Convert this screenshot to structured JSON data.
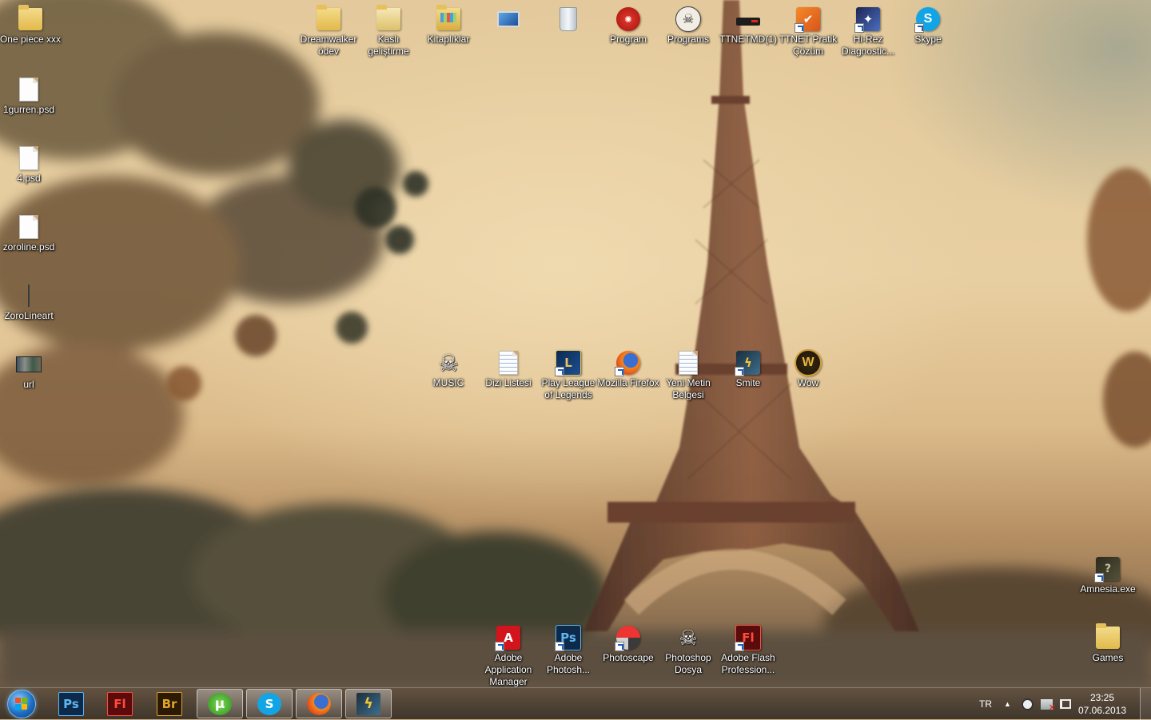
{
  "desktop": {
    "icons": [
      {
        "name": "One piece xxx",
        "kind": "folder"
      },
      {
        "name": "1gurren.psd",
        "kind": "file"
      },
      {
        "name": "4.psd",
        "kind": "file"
      },
      {
        "name": "zoroline.psd",
        "kind": "file"
      },
      {
        "name": "ZoroLineart",
        "kind": "image"
      },
      {
        "name": "url",
        "kind": "image"
      },
      {
        "name": "Dreamwalker ödev",
        "kind": "folder"
      },
      {
        "name": "Kaslı geliştirme",
        "kind": "folder"
      },
      {
        "name": "Kitaplıklar",
        "kind": "libraries"
      },
      {
        "name": "",
        "kind": "computer"
      },
      {
        "name": "",
        "kind": "recycle-bin"
      },
      {
        "name": "Program",
        "kind": "folder"
      },
      {
        "name": "Programs",
        "kind": "folder"
      },
      {
        "name": "TTNETMD(1)",
        "kind": "app"
      },
      {
        "name": "TTNET Pratik Çözüm",
        "kind": "shortcut"
      },
      {
        "name": "Hi-Rez Diagnostic...",
        "kind": "shortcut"
      },
      {
        "name": "Skype",
        "kind": "shortcut"
      },
      {
        "name": "MUSIC",
        "kind": "folder"
      },
      {
        "name": "Dizi Listesi",
        "kind": "text-file"
      },
      {
        "name": "Play League of Legends",
        "kind": "shortcut"
      },
      {
        "name": "Mozilla Firefox",
        "kind": "shortcut"
      },
      {
        "name": "Yeni Metin Belgesi",
        "kind": "text-file"
      },
      {
        "name": "Smite",
        "kind": "shortcut"
      },
      {
        "name": "Wow",
        "kind": "shortcut"
      },
      {
        "name": "Amnesia.exe",
        "kind": "shortcut"
      },
      {
        "name": "Adobe Application Manager",
        "kind": "shortcut"
      },
      {
        "name": "Adobe Photosh...",
        "kind": "shortcut"
      },
      {
        "name": "Photoscape",
        "kind": "shortcut"
      },
      {
        "name": "Photoshop Dosya",
        "kind": "folder"
      },
      {
        "name": "Adobe Flash Profession...",
        "kind": "shortcut"
      },
      {
        "name": "Games",
        "kind": "folder"
      }
    ]
  },
  "taskbar": {
    "pinned": [
      {
        "icon": "photoshop-icon",
        "text": "Ps"
      },
      {
        "icon": "flash-icon",
        "text": "Fl"
      },
      {
        "icon": "bridge-icon",
        "text": "Br"
      },
      {
        "icon": "utorrent-icon",
        "text": ""
      },
      {
        "icon": "skype-icon",
        "text": "S"
      },
      {
        "icon": "firefox-icon",
        "text": ""
      },
      {
        "icon": "smite-icon",
        "text": ""
      }
    ],
    "tray": {
      "language": "TR",
      "time": "23:25",
      "date": "07.06.2013"
    }
  },
  "colors": {
    "accent": "#1b6fc4",
    "sky": "#e8cfa2",
    "tower": "#5a3b2c"
  }
}
